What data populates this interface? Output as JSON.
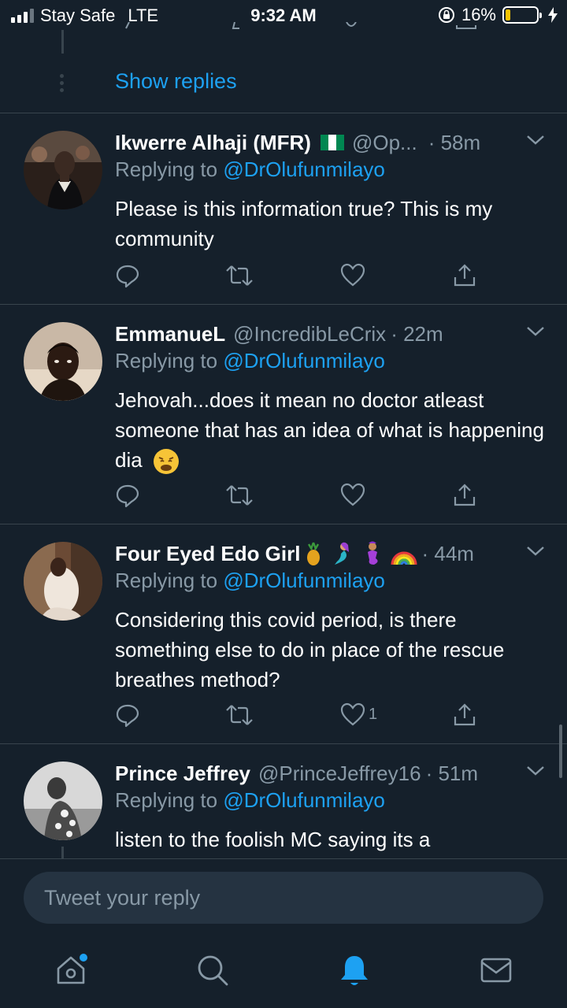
{
  "status_bar": {
    "carrier": "Stay Safe",
    "network": "LTE",
    "time": "9:32 AM",
    "battery_percent_label": "16%",
    "battery_level": 0.16
  },
  "thread": {
    "show_replies_label": "Show replies"
  },
  "tweets": [
    {
      "display_name": "Ikwerre Alhaji (MFR)",
      "handle": "@Op...",
      "time": "· 58m",
      "replying_prefix": "Replying to",
      "replying_to": "@DrOlufunmilayo",
      "text": "Please is this information true? This is my community",
      "like_count": ""
    },
    {
      "display_name": "EmmanueL",
      "handle": "@IncredibLeCrix",
      "time": "· 22m",
      "replying_prefix": "Replying to",
      "replying_to": "@DrOlufunmilayo",
      "text": "Jehovah...does it mean no doctor atleast someone that has an idea of what is happening dia",
      "like_count": ""
    },
    {
      "display_name": "Four Eyed Edo Girl",
      "handle": "",
      "time": "· 44m",
      "replying_prefix": "Replying to",
      "replying_to": "@DrOlufunmilayo",
      "text": "Considering this covid period, is there something else to do in place of the rescue breathes method?",
      "like_count": "1"
    },
    {
      "display_name": "Prince Jeffrey",
      "handle": "@PrinceJeffrey16",
      "time": "· 51m",
      "replying_prefix": "Replying to",
      "replying_to": "@DrOlufunmilayo",
      "text": "listen to the foolish MC saying its a",
      "like_count": ""
    }
  ],
  "compose": {
    "placeholder": "Tweet your reply"
  },
  "colors": {
    "background": "#15202b",
    "accent": "#1da1f2",
    "secondary_text": "#8899a6",
    "divider": "#38444d"
  },
  "icons": {
    "reply": "reply-icon",
    "retweet": "retweet-icon",
    "like": "heart-icon",
    "share": "share-icon",
    "more": "chevron-down-icon",
    "home": "home-icon",
    "search": "search-icon",
    "notifications": "bell-icon",
    "messages": "mail-icon"
  }
}
